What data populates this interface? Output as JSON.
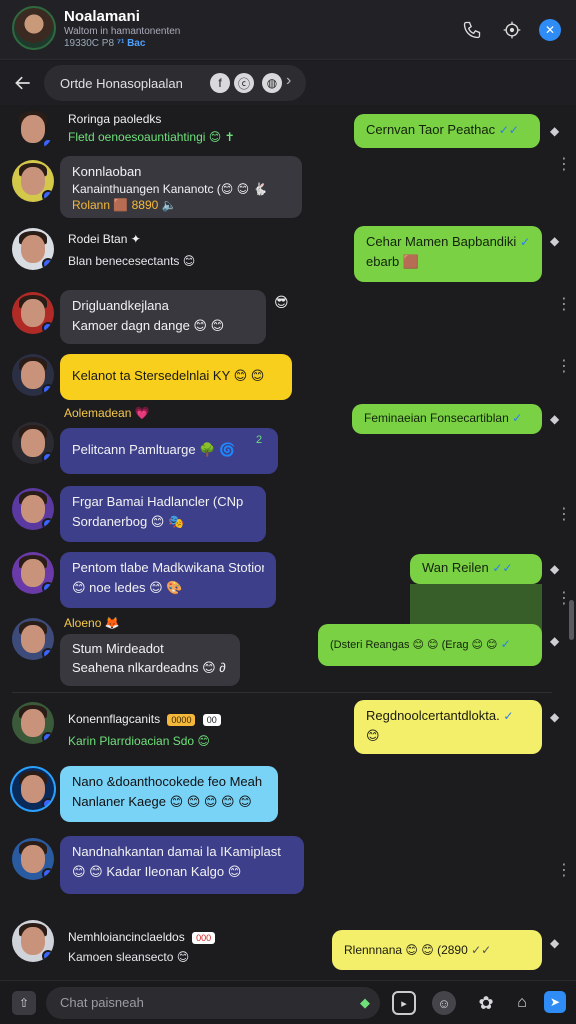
{
  "header": {
    "title": "Noalamani",
    "subtitle": "Waltom in hamantonenten",
    "status": "19330C P8",
    "status_tail": "⁷¹ Bac",
    "icons": [
      "phone-icon",
      "settings-icon",
      "close-icon"
    ]
  },
  "search": {
    "back_icon": "arrow-left-icon",
    "text": "Ortde Honasoplaalan",
    "chips": [
      "f",
      "ⓒ",
      "◍"
    ],
    "chevron": "›"
  },
  "messages": [
    {
      "name": "Roringa paoledks",
      "sub": "Fletd oenoesoauntiahtingi 😊 ✝",
      "sub_color": "#6fe07a",
      "bubble": null
    },
    {
      "name": "Konnlaoban",
      "line1": "Kanainthuangen Kananotc (😊 😊 🐇",
      "line2": "Rolann 🟫 8890 🔈",
      "style": "gray"
    },
    {
      "name": "Rodei Btan ✦",
      "sub": "Blan benecesectants 😊",
      "bubble": null
    },
    {
      "name": "",
      "line1": "Drigluandkejlana",
      "line2": "Kamoer dagn dange 😊 😊",
      "style": "gray"
    },
    {
      "name": "",
      "line1": "Kelanot ta Stersedelnlai KY 😊 😊",
      "line2": "",
      "style": "yellow"
    },
    {
      "name": "Aolemadean 💗",
      "line1": "Pelitcann Pamltuarge 🌳 🌀",
      "line2": "",
      "style": "indigo"
    },
    {
      "name": "",
      "line1": "Frgar Bamai Hadlancler (CNp",
      "line2": "Sordanerbog 😊 🎭",
      "style": "indigo"
    },
    {
      "name": "",
      "line1": "Pentom tlabe Madkwikana Stotion",
      "line2": "😊 noe ledes 😊 🎨",
      "style": "indigo"
    },
    {
      "name": "Aloeno 🦊",
      "line1": "Stum Mirdeadot",
      "line2": "Seahena nlkardeadns 😊 ∂",
      "style": "gray"
    },
    {
      "name": "Konennflagcanits",
      "sub": "Karin Plarrdioacian Sdo 😊",
      "bubble": null,
      "badge1": "0000",
      "badge2": "00"
    },
    {
      "name": "",
      "line1": "Nano &doanthocokede feo Meah",
      "line2": "Nanlaner Kaege 😊 😊 😊 😊 😊",
      "style": "sky"
    },
    {
      "name": "",
      "line1": "Nandnahkantan damai la IKamiplast",
      "line2": "😊 😊 Kadar Ileonan Kalgo 😊",
      "style": "indigo"
    },
    {
      "name": "Nemhloiancinclaeldos",
      "sub": "Kamoen sleansecto 😊",
      "bubble": null,
      "badge1": "000"
    }
  ],
  "outgoing": [
    {
      "text": "Cernvan Taor Peathac",
      "ticks": "✓✓"
    },
    {
      "text": "Cehar Mamen Bapbandiki",
      "text2": "ebarb 🟫",
      "ticks": "✓"
    },
    {
      "text": "Feminaeian Fonsecartiblan",
      "ticks": "✓"
    },
    {
      "text": "Wan Reilen",
      "ticks": "✓✓"
    },
    {
      "text": "(Dsteri Reangas 😊 😊 (Erag 😊 😊",
      "ticks": "✓"
    },
    {
      "text": "Regdnoolcertantdlokta.",
      "text2": "😊",
      "ticks": "✓"
    },
    {
      "text": "Rlennnana 😊 😊 (2890",
      "ticks": "✓✓"
    }
  ],
  "composer": {
    "placeholder": "Chat paisneah",
    "icons": [
      "attach-icon",
      "emoji-icon",
      "sticker-icon",
      "game-icon",
      "home-icon",
      "send-icon"
    ]
  },
  "colors": {
    "accent": "#2a7df2",
    "green": "#7ad144",
    "yellow": "#f7cf1c",
    "indigo": "#3d3f8a"
  }
}
